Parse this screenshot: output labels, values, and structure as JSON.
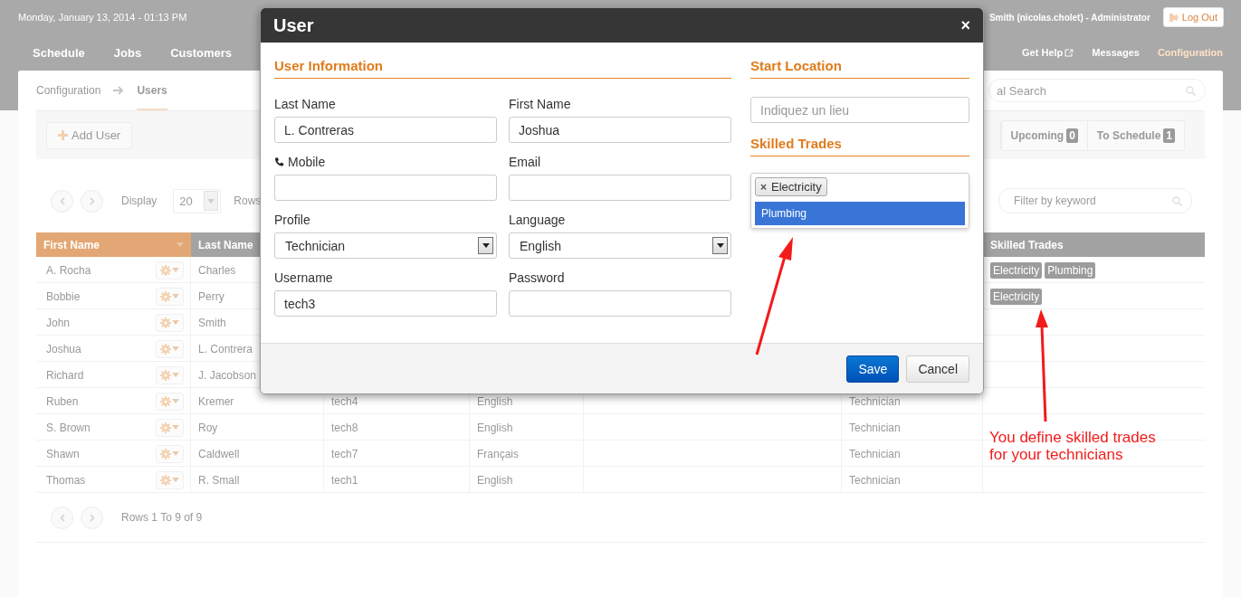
{
  "header": {
    "date": "Monday, January 13, 2014 - 01:13 PM",
    "user": "Smith (nicolas.cholet) - Administrator",
    "logout": "Log Out"
  },
  "nav": {
    "left": [
      {
        "label": "Schedule",
        "selected": false
      },
      {
        "label": "Jobs",
        "selected": false
      },
      {
        "label": "Customers",
        "selected": false
      }
    ],
    "right": [
      {
        "label": "Get Help",
        "kind": "external",
        "selected": false
      },
      {
        "label": "Messages",
        "kind": "link",
        "selected": false
      },
      {
        "label": "Configuration",
        "kind": "link",
        "selected": true
      }
    ]
  },
  "breadcrumb": [
    {
      "label": "Configuration",
      "selected": false
    },
    {
      "label": "Users",
      "selected": true
    }
  ],
  "search": {
    "placeholder": "al Search"
  },
  "toolbar": {
    "add_button": "Add User",
    "counters": [
      {
        "label": "Upcoming",
        "count": "0"
      },
      {
        "label": "To Schedule",
        "count": "1"
      }
    ]
  },
  "pager": {
    "display_label": "Display",
    "page_size": "20",
    "rows_label": "Rows",
    "filter_placeholder": "Filter by keyword",
    "summary": "Rows 1 To 9 of 9"
  },
  "table": {
    "columns": {
      "first_name": {
        "label": "First Name",
        "sorted": true
      },
      "last_name": {
        "label": "Last Name",
        "sorted": false
      },
      "skilled_trades": {
        "label": "Skilled Trades",
        "sorted": false
      }
    },
    "rows": [
      {
        "first_name": "A. Rocha",
        "last_name": "Charles",
        "skilled_trades": [
          "Electricity",
          "Plumbing"
        ]
      },
      {
        "first_name": "Bobbie",
        "last_name": "Perry",
        "skilled_trades": [
          "Electricity"
        ]
      },
      {
        "first_name": "John",
        "last_name": "Smith"
      },
      {
        "first_name": "Joshua",
        "last_name": "L. Contrera"
      },
      {
        "first_name": "Richard",
        "last_name": "J. Jacobson"
      },
      {
        "first_name": "Ruben",
        "last_name": "Kremer",
        "column_3": "tech4",
        "column_4": "English",
        "column_6": "Technician"
      },
      {
        "first_name": "S. Brown",
        "last_name": "Roy",
        "column_3": "tech8",
        "column_4": "English",
        "column_6": "Technician"
      },
      {
        "first_name": "Shawn",
        "last_name": "Caldwell",
        "column_3": "tech7",
        "column_4": "Français",
        "column_6": "Technician"
      },
      {
        "first_name": "Thomas",
        "last_name": "R. Small",
        "column_3": "tech1",
        "column_4": "English",
        "column_6": "Technician"
      }
    ]
  },
  "dialog": {
    "title": "User",
    "close": "×",
    "user_info": {
      "heading": "User Information",
      "fields": [
        {
          "label": "Last Name",
          "value": "L. Contreras",
          "kind": "text"
        },
        {
          "label": "First Name",
          "value": "Joshua",
          "kind": "text"
        },
        {
          "label": "Mobile",
          "kind": "phone"
        },
        {
          "label": "Email",
          "kind": "text"
        },
        {
          "label": "Profile",
          "value": "Technician",
          "kind": "select"
        },
        {
          "label": "Language",
          "value": "English",
          "kind": "select"
        },
        {
          "label": "Username",
          "value": "tech3",
          "kind": "text"
        },
        {
          "label": "Password",
          "kind": "password"
        }
      ]
    },
    "start_location": {
      "heading": "Start Location",
      "placeholder": "Indiquez un lieu"
    },
    "skilled_trades": {
      "heading": "Skilled Trades",
      "tags": [
        {
          "label": "Electricity",
          "remove": "×"
        }
      ],
      "options": [
        {
          "label": "Plumbing",
          "selected": true
        }
      ]
    },
    "buttons": [
      {
        "label": "Save",
        "kind": "primary"
      },
      {
        "label": "Cancel",
        "kind": "default"
      }
    ]
  },
  "annotation": {
    "lines": [
      "You define skilled trades",
      "for your technicians"
    ]
  }
}
